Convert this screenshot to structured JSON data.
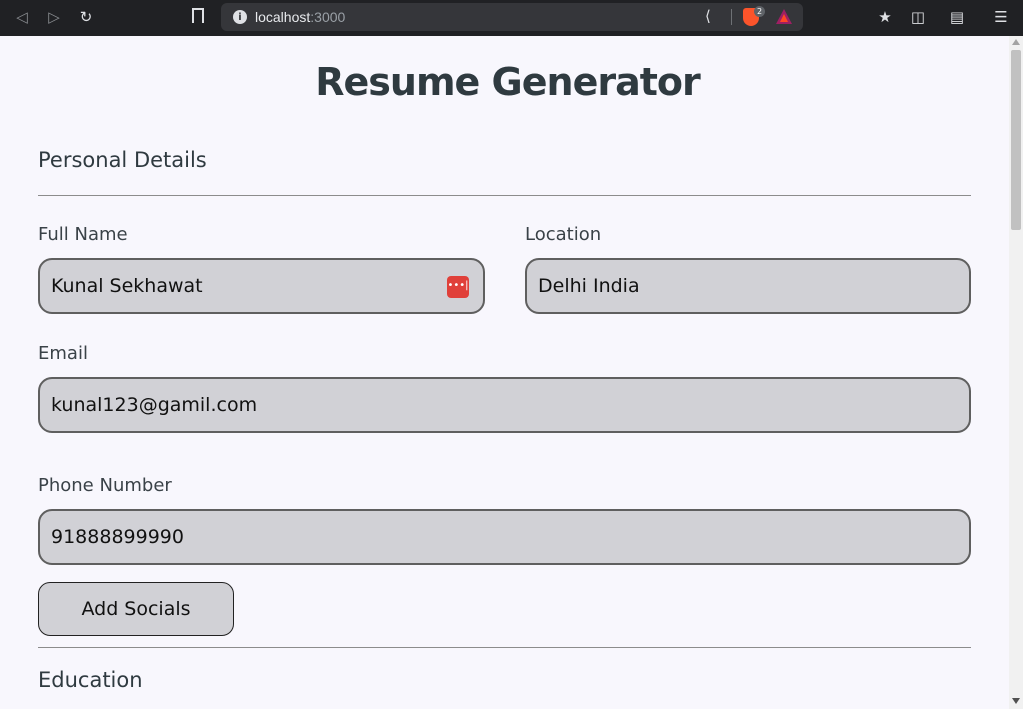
{
  "browser": {
    "url_host": "localhost",
    "url_port": ":3000",
    "brave_badge": "2"
  },
  "page": {
    "title": "Resume Generator",
    "personal_section": "Personal Details",
    "full_name_label": "Full Name",
    "full_name_value": "Kunal Sekhawat",
    "location_label": "Location",
    "location_value": "Delhi India",
    "email_label": "Email",
    "email_value": "kunal123@gamil.com",
    "phone_label": "Phone Number",
    "phone_value": "91888899990",
    "add_socials_label": "Add Socials",
    "education_section": "Education"
  },
  "colors": {
    "field_bg": "#d1d1d6",
    "page_bg": "#f8f7fd",
    "password_icon": "#e0403a"
  }
}
